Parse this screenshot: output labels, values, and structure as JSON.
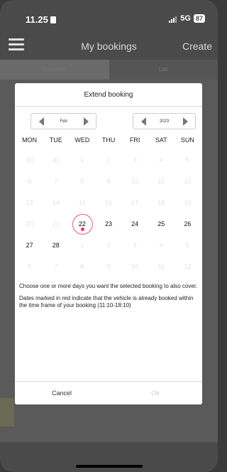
{
  "status_bar": {
    "time": "11.25",
    "network": "5G",
    "battery": "87"
  },
  "header": {
    "title": "My bookings",
    "create_label": "Create"
  },
  "tabs": [
    {
      "label": "Calendar"
    },
    {
      "label": "List"
    }
  ],
  "modal": {
    "title": "Extend booking",
    "month": "Feb",
    "year": "2023",
    "weekdays": [
      "MON",
      "TUE",
      "WED",
      "THU",
      "FRI",
      "SAT",
      "SUN"
    ],
    "days": [
      {
        "d": "30",
        "s": "disabled"
      },
      {
        "d": "31",
        "s": "disabled"
      },
      {
        "d": "1",
        "s": "disabled"
      },
      {
        "d": "2",
        "s": "disabled"
      },
      {
        "d": "3",
        "s": "disabled"
      },
      {
        "d": "4",
        "s": "disabled"
      },
      {
        "d": "5",
        "s": "disabled"
      },
      {
        "d": "6",
        "s": "disabled"
      },
      {
        "d": "7",
        "s": "disabled"
      },
      {
        "d": "8",
        "s": "disabled"
      },
      {
        "d": "9",
        "s": "disabled"
      },
      {
        "d": "10",
        "s": "disabled"
      },
      {
        "d": "11",
        "s": "disabled"
      },
      {
        "d": "12",
        "s": "disabled"
      },
      {
        "d": "13",
        "s": "disabled"
      },
      {
        "d": "14",
        "s": "disabled"
      },
      {
        "d": "15",
        "s": "disabled"
      },
      {
        "d": "16",
        "s": "disabled"
      },
      {
        "d": "17",
        "s": "disabled"
      },
      {
        "d": "18",
        "s": "disabled"
      },
      {
        "d": "19",
        "s": "disabled"
      },
      {
        "d": "20",
        "s": "disabled"
      },
      {
        "d": "21",
        "s": "disabled"
      },
      {
        "d": "22",
        "s": "today"
      },
      {
        "d": "23",
        "s": "enabled"
      },
      {
        "d": "24",
        "s": "enabled"
      },
      {
        "d": "25",
        "s": "enabled"
      },
      {
        "d": "26",
        "s": "enabled"
      },
      {
        "d": "27",
        "s": "enabled"
      },
      {
        "d": "28",
        "s": "enabled"
      },
      {
        "d": "1",
        "s": "disabled"
      },
      {
        "d": "2",
        "s": "disabled"
      },
      {
        "d": "3",
        "s": "disabled"
      },
      {
        "d": "4",
        "s": "disabled"
      },
      {
        "d": "5",
        "s": "disabled"
      },
      {
        "d": "6",
        "s": "disabled"
      },
      {
        "d": "7",
        "s": "disabled"
      },
      {
        "d": "8",
        "s": "disabled"
      },
      {
        "d": "9",
        "s": "disabled"
      },
      {
        "d": "10",
        "s": "disabled"
      },
      {
        "d": "11",
        "s": "disabled"
      },
      {
        "d": "12",
        "s": "disabled"
      }
    ],
    "instruction": "Choose one or more days you want the selected booking to also cover.",
    "legend_note": "Dates marked in red indicate that the vehicle is already booked within the time frame of your booking (11:10-18:10)",
    "cancel_label": "Cancel",
    "ok_label": "Ok"
  },
  "colors": {
    "today_ring": "#e65a8a",
    "today_dot": "#e6336e",
    "overlay": "#4a4a4a"
  }
}
